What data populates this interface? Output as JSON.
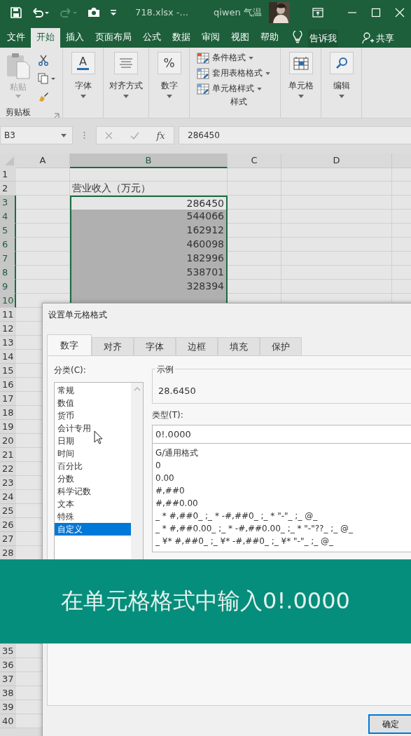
{
  "title_bar": {
    "file_name": "718.xlsx  -...",
    "user": "qiwen 气温"
  },
  "ribbon_tabs": [
    {
      "label": "文件",
      "selected": false
    },
    {
      "label": "开始",
      "selected": true
    },
    {
      "label": "插入",
      "selected": false
    },
    {
      "label": "页面布局",
      "selected": false
    },
    {
      "label": "公式",
      "selected": false
    },
    {
      "label": "数据",
      "selected": false
    },
    {
      "label": "审阅",
      "selected": false
    },
    {
      "label": "视图",
      "selected": false
    },
    {
      "label": "帮助",
      "selected": false
    }
  ],
  "tell_me": "告诉我",
  "share": "共享",
  "ribbon_groups": [
    {
      "kind": "clipboard",
      "label": "剪贴板",
      "paste": {
        "label": "粘贴",
        "disabled": true
      }
    },
    {
      "kind": "dropdown",
      "glyph": "A",
      "label": "字体"
    },
    {
      "kind": "dropdown",
      "label": "对齐方式"
    },
    {
      "kind": "dropdown",
      "glyph": "%",
      "label": "数字"
    },
    {
      "kind": "styles",
      "label": "样式",
      "items": [
        "条件格式",
        "套用表格格式",
        "单元格样式"
      ]
    },
    {
      "kind": "dropdown",
      "label": "单元格"
    },
    {
      "kind": "dropdown",
      "label": "编辑"
    }
  ],
  "formula_bar": {
    "name_box": "B3",
    "fx": "fx",
    "value": "286450"
  },
  "sheet": {
    "columns": [
      {
        "label": "A",
        "selected": false
      },
      {
        "label": "B",
        "selected": true
      },
      {
        "label": "C",
        "selected": false
      },
      {
        "label": "D",
        "selected": false
      }
    ],
    "rows": [
      {
        "number": "1",
        "selected": false
      },
      {
        "number": "2",
        "selected": false,
        "value": "营业收入（万元）",
        "kind": "text"
      },
      {
        "number": "3",
        "selected": true,
        "active": true,
        "value": "286450",
        "kind": "number"
      },
      {
        "number": "4",
        "selected": true,
        "active": false,
        "value": "544066",
        "kind": "number"
      },
      {
        "number": "5",
        "selected": true,
        "active": false,
        "value": "162912",
        "kind": "number"
      },
      {
        "number": "6",
        "selected": true,
        "active": false,
        "value": "460098",
        "kind": "number"
      },
      {
        "number": "7",
        "selected": true,
        "active": false,
        "value": "182996",
        "kind": "number"
      },
      {
        "number": "8",
        "selected": true,
        "active": false,
        "value": "538701",
        "kind": "number"
      },
      {
        "number": "9",
        "selected": true,
        "active": false,
        "value": "328394",
        "kind": "number"
      },
      {
        "number": "10",
        "selected": true,
        "active": false
      },
      {
        "number": "11",
        "selected": false
      },
      {
        "number": "12",
        "selected": false
      },
      {
        "number": "13",
        "selected": false
      },
      {
        "number": "14",
        "selected": false
      },
      {
        "number": "15",
        "selected": false
      },
      {
        "number": "16",
        "selected": false
      },
      {
        "number": "17",
        "selected": false
      },
      {
        "number": "18",
        "selected": false
      },
      {
        "number": "19",
        "selected": false
      },
      {
        "number": "20",
        "selected": false
      },
      {
        "number": "21",
        "selected": false
      },
      {
        "number": "22",
        "selected": false
      },
      {
        "number": "23",
        "selected": false
      },
      {
        "number": "24",
        "selected": false
      },
      {
        "number": "25",
        "selected": false
      },
      {
        "number": "26",
        "selected": false
      },
      {
        "number": "27",
        "selected": false
      },
      {
        "number": "28",
        "selected": false
      }
    ],
    "rows_after_banner": [
      {
        "number": "35",
        "selected": false
      },
      {
        "number": "36",
        "selected": false
      },
      {
        "number": "37",
        "selected": false
      },
      {
        "number": "38",
        "selected": false
      },
      {
        "number": "39",
        "selected": false
      },
      {
        "number": "40",
        "selected": false
      }
    ]
  },
  "dialog": {
    "title": "设置单元格格式",
    "tabs": [
      {
        "label": "数字",
        "selected": true
      },
      {
        "label": "对齐",
        "selected": false
      },
      {
        "label": "字体",
        "selected": false
      },
      {
        "label": "边框",
        "selected": false
      },
      {
        "label": "填充",
        "selected": false
      },
      {
        "label": "保护",
        "selected": false
      }
    ],
    "category_label": "分类(C):",
    "categories": [
      {
        "label": "常规",
        "selected": false
      },
      {
        "label": "数值",
        "selected": false
      },
      {
        "label": "货币",
        "selected": false
      },
      {
        "label": "会计专用",
        "selected": false
      },
      {
        "label": "日期",
        "selected": false
      },
      {
        "label": "时间",
        "selected": false
      },
      {
        "label": "百分比",
        "selected": false
      },
      {
        "label": "分数",
        "selected": false
      },
      {
        "label": "科学记数",
        "selected": false
      },
      {
        "label": "文本",
        "selected": false
      },
      {
        "label": "特殊",
        "selected": false
      },
      {
        "label": "自定义",
        "selected": true
      }
    ],
    "sample_label": "示例",
    "sample_value": "28.6450",
    "type_label": "类型(T):",
    "type_value": "0!.0000",
    "types": [
      "G/通用格式",
      "0",
      "0.00",
      "#,##0",
      "#,##0.00",
      "_ * #,##0_ ;_ * -#,##0_ ;_ * \"-\"_ ;_ @_",
      "_ * #,##0.00_ ;_ * -#,##0.00_ ;_ * \"-\"??_ ;_ @_",
      "_ ¥* #,##0_ ;_ ¥* -#,##0_ ;_ ¥* \"-\"_ ;_ @_"
    ],
    "ok_button": "确定"
  },
  "banner": {
    "caption": "在单元格格式中输入0!.0000"
  }
}
